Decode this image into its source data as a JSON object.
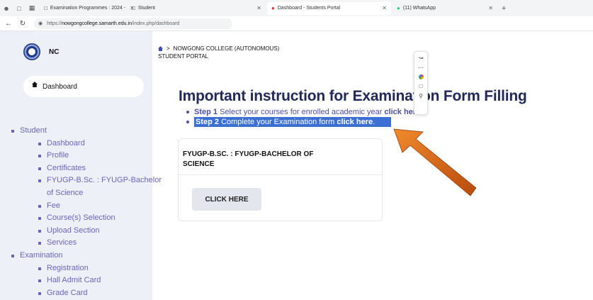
{
  "browser": {
    "tabs": [
      {
        "label": "Examination Programmes : 2024 -",
        "active": false
      },
      {
        "label": "Student",
        "active": false
      },
      {
        "label": "Dashboard - Students Portal",
        "active": true
      },
      {
        "label": "(11) WhatsApp",
        "active": false
      }
    ],
    "new_tab": "+",
    "url_prefix": "https://",
    "url_host": "nowgongcollege.samarth.edu.in",
    "url_path": "/index.php/dashboard"
  },
  "sidebar": {
    "brand": "NC",
    "dashboard_label": "Dashboard",
    "menu": [
      {
        "label": "Student",
        "children": [
          "Dashboard",
          "Profile",
          "Certificates",
          "FYUGP-B.Sc. : FYUGP-Bachelor of Science",
          "Fee",
          "Course(s) Selection",
          "Upload Section",
          "Services"
        ]
      },
      {
        "label": "Examination",
        "children": [
          "Registration",
          "Hall Admit Card",
          "Grade Card"
        ]
      }
    ]
  },
  "breadcrumb": {
    "college": "NOWGONG COLLEGE (AUTONOMOUS)",
    "portal": "STUDENT PORTAL"
  },
  "main": {
    "heading": "Important instruction for Examination Form Filling",
    "step1_label": "Step 1",
    "step1_text": "Select your courses for enrolled academic year",
    "step1_link": "click here",
    "step2_label": "Step 2",
    "step2_text": "Complete your Examination form",
    "step2_link": "click here",
    "card_title": "FYUGP-B.SC. : FYUGP-BACHELOR OF SCIENCE",
    "card_button": "CLICK HERE"
  },
  "icons": {
    "home": "home-icon",
    "lock": "lock-icon"
  },
  "colors": {
    "sidebar_bg": "#eef0f8",
    "menu_text": "#6b63c2",
    "heading": "#22285a",
    "step_text": "#4b4fa8",
    "selection": "#3b6fd4",
    "annotation_arrow": "#e06a18"
  }
}
